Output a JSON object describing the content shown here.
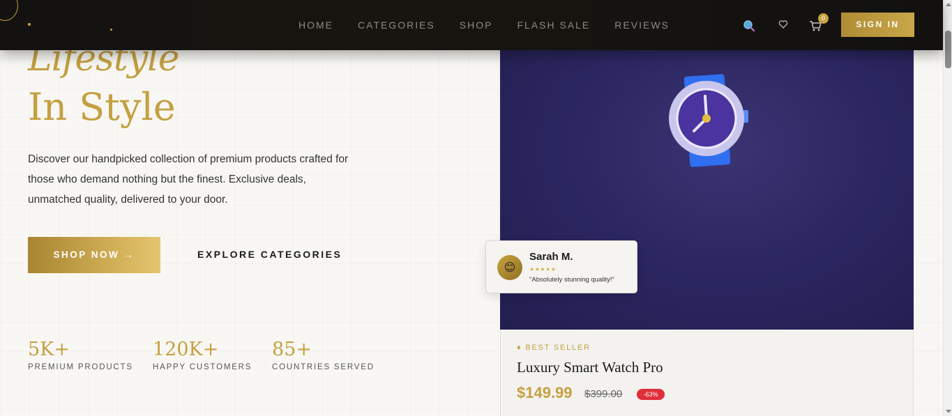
{
  "nav": {
    "links": [
      "HOME",
      "CATEGORIES",
      "SHOP",
      "FLASH SALE",
      "REVIEWS"
    ],
    "icons": [
      "search-icon",
      "heart-icon",
      "cart-icon"
    ],
    "cart_count": "0",
    "signin_label": "SIGN IN"
  },
  "hero": {
    "title_line1": "Lifestyle",
    "title_line2": "In Style",
    "description": "Discover our handpicked collection of premium products crafted for those who demand nothing but the finest. Exclusive deals, unmatched quality, delivered to your door.",
    "shop_now_label": "SHOP NOW →",
    "explore_label": "EXPLORE CATEGORIES"
  },
  "stats": [
    {
      "value": "5K+",
      "label": "PREMIUM PRODUCTS"
    },
    {
      "value": "120K+",
      "label": "HAPPY CUSTOMERS"
    },
    {
      "value": "85+",
      "label": "COUNTRIES SERVED"
    }
  ],
  "review": {
    "name": "Sarah M.",
    "stars": "★★★★★",
    "text": "\"Absolutely stunning quality!\"",
    "avatar_emoji": "😊"
  },
  "product": {
    "badge": "♦ BEST SELLER",
    "name": "Luxury Smart Watch Pro",
    "price": "$149.99",
    "old_price": "$399.00",
    "discount": "-63%",
    "image_icon": "watch-icon"
  },
  "colors": {
    "gold": "#c4a041",
    "nav_bg": "#141210",
    "product_bg": "#2c2762",
    "discount_red": "#e02f3a"
  }
}
